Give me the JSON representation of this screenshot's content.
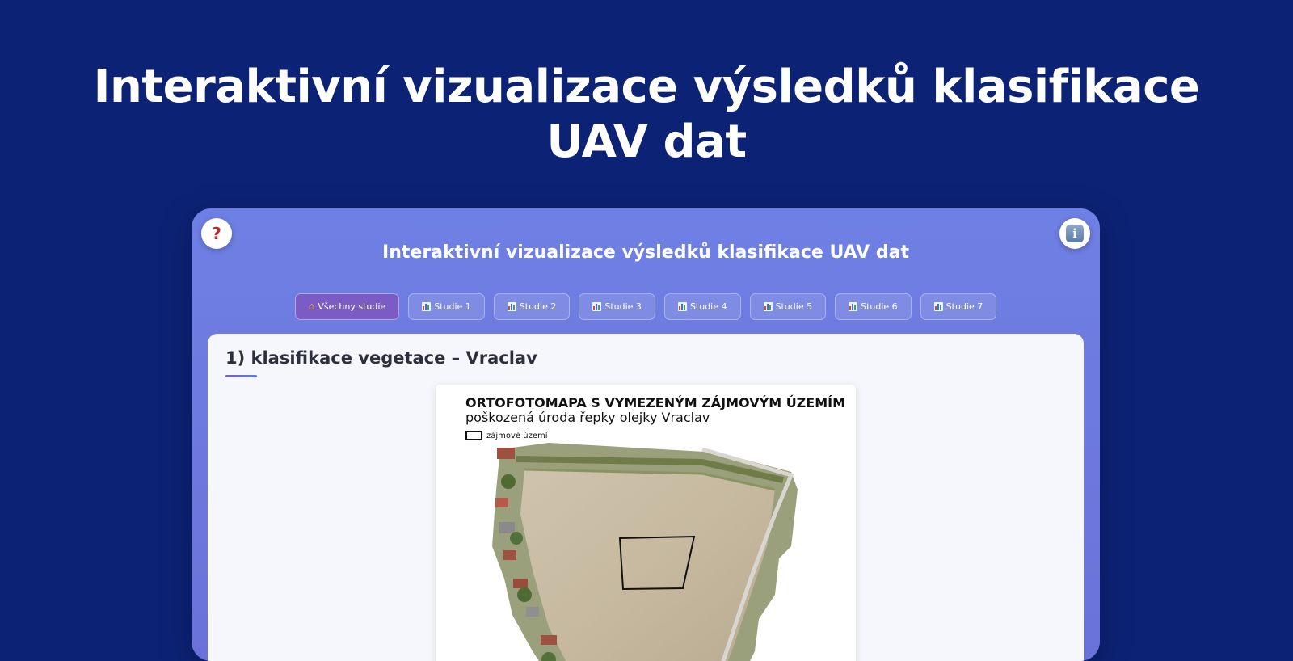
{
  "hero": {
    "title_line1": "Interaktivní vizualizace výsledků klasifikace",
    "title_line2": "UAV dat"
  },
  "app": {
    "title": "Interaktivní vizualizace výsledků klasifikace UAV dat",
    "help_label": "?",
    "info_label": "i",
    "tabs": [
      {
        "label": "Všechny studie",
        "icon": "home-icon",
        "active": true
      },
      {
        "label": "Studie 1",
        "icon": "bar-chart-icon"
      },
      {
        "label": "Studie 2",
        "icon": "bar-chart-icon"
      },
      {
        "label": "Studie 3",
        "icon": "bar-chart-icon"
      },
      {
        "label": "Studie 4",
        "icon": "bar-chart-icon"
      },
      {
        "label": "Studie 5",
        "icon": "bar-chart-icon"
      },
      {
        "label": "Studie 6",
        "icon": "bar-chart-icon"
      },
      {
        "label": "Studie 7",
        "icon": "bar-chart-icon"
      }
    ],
    "accent_color": "#7a5cc4"
  },
  "section": {
    "title": "1) klasifikace vegetace – Vraclav"
  },
  "map": {
    "heading": "ORTOFOTOMAPA S VYMEZENÝM ZÁJMOVÝM ÚZEMÍM",
    "subheading": "poškozená úroda řepky olejky Vraclav",
    "legend_label": "zájmové území"
  }
}
